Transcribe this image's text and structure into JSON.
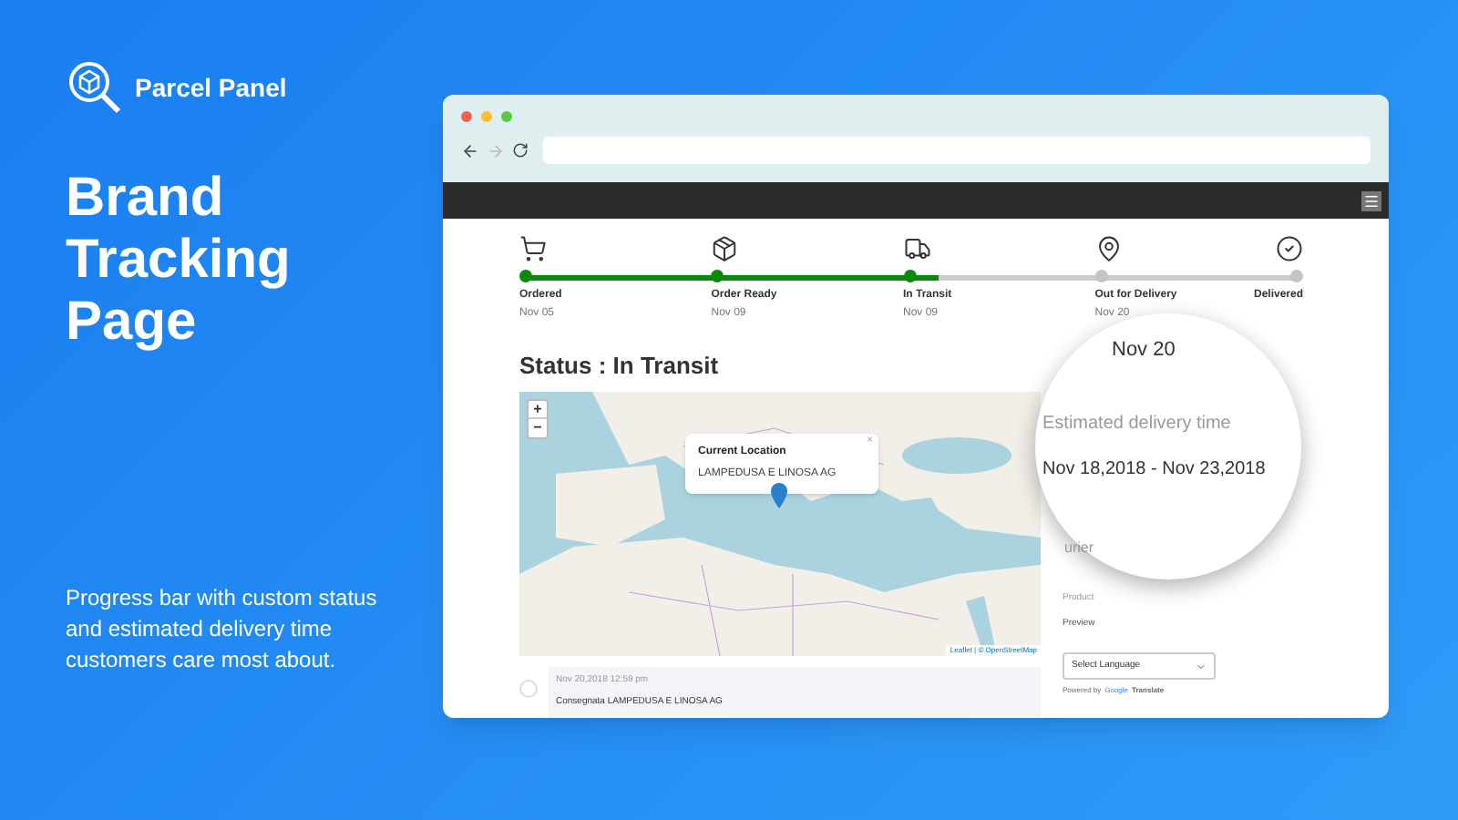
{
  "brand": {
    "name": "Parcel Panel"
  },
  "headline": [
    "Brand",
    "Tracking",
    "Page"
  ],
  "description": "Progress bar with custom status and estimated delivery time customers care most about.",
  "progress": {
    "level": 0.54,
    "steps": [
      {
        "kind": "cart",
        "label": "Ordered",
        "date": "Nov 05",
        "completed": true
      },
      {
        "kind": "package",
        "label": "Order Ready",
        "date": "Nov 09",
        "completed": true
      },
      {
        "kind": "truck",
        "label": "In Transit",
        "date": "Nov 09",
        "completed": true
      },
      {
        "kind": "pin",
        "label": "Out for Delivery",
        "date": "Nov 20",
        "completed": false
      },
      {
        "kind": "check",
        "label": "Delivered",
        "completed": false
      }
    ]
  },
  "status_heading": "Status : In Transit",
  "map": {
    "zoom_in": "+",
    "zoom_out": "−",
    "popup_title": "Current Location",
    "popup_text": "LAMPEDUSA E LINOSA AG",
    "popup_close": "×",
    "attribution": "Leaflet | © OpenStreetMap"
  },
  "event": {
    "time": "Nov 20,2018 12:59 pm",
    "text": "Consegnata LAMPEDUSA E LINOSA AG"
  },
  "magnifier": {
    "date": "Nov 20",
    "label": "Estimated delivery time",
    "range": "Nov 18,2018 - Nov 23,2018"
  },
  "sidebar": {
    "courier_fragment": "urier",
    "product_label": "Product",
    "product_value": "Preview",
    "language_select": "Select Language",
    "powered_by": "Powered by",
    "google": "Google",
    "translate": "Translate"
  }
}
